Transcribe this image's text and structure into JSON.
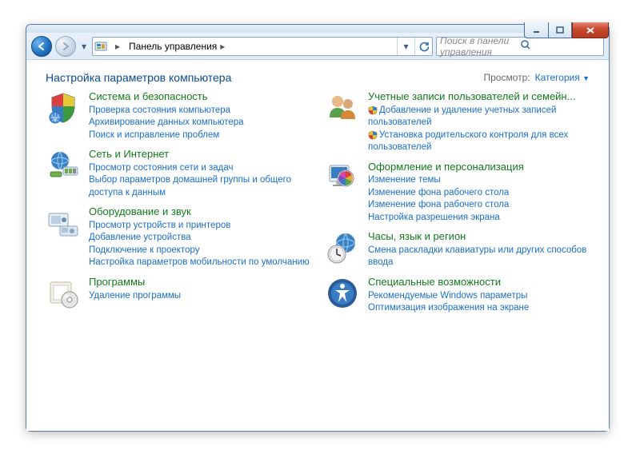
{
  "window": {
    "breadcrumb": "Панель управления",
    "search_placeholder": "Поиск в панели управления"
  },
  "header": {
    "title": "Настройка параметров компьютера",
    "view_label": "Просмотр:",
    "view_mode": "Категория"
  },
  "left": [
    {
      "icon": "system-security-icon",
      "title": "Система и безопасность",
      "links": [
        {
          "text": "Проверка состояния компьютера"
        },
        {
          "text": "Архивирование данных компьютера"
        },
        {
          "text": "Поиск и исправление проблем"
        }
      ]
    },
    {
      "icon": "network-icon",
      "title": "Сеть и Интернет",
      "links": [
        {
          "text": "Просмотр состояния сети и задач"
        },
        {
          "text": "Выбор параметров домашней группы и общего доступа к данным"
        }
      ]
    },
    {
      "icon": "hardware-sound-icon",
      "title": "Оборудование и звук",
      "links": [
        {
          "text": "Просмотр устройств и принтеров"
        },
        {
          "text": "Добавление устройства"
        },
        {
          "text": "Подключение к проектору"
        },
        {
          "text": "Настройка параметров мобильности по умолчанию"
        }
      ]
    },
    {
      "icon": "programs-icon",
      "title": "Программы",
      "links": [
        {
          "text": "Удаление программы"
        }
      ]
    }
  ],
  "right": [
    {
      "icon": "user-accounts-icon",
      "title": "Учетные записи пользователей и семейн...",
      "links": [
        {
          "text": "Добавление и удаление учетных записей пользователей",
          "shield": true
        },
        {
          "text": "Установка родительского контроля для всех пользователей",
          "shield": true
        }
      ]
    },
    {
      "icon": "appearance-icon",
      "title": "Оформление и персонализация",
      "links": [
        {
          "text": "Изменение темы"
        },
        {
          "text": "Изменение фона рабочего стола"
        },
        {
          "text": "Изменение фона рабочего стола"
        },
        {
          "text": "Настройка разрешения экрана"
        }
      ]
    },
    {
      "icon": "clock-lang-region-icon",
      "title": "Часы, язык и регион",
      "links": [
        {
          "text": "Смена раскладки клавиатуры или других способов ввода"
        }
      ]
    },
    {
      "icon": "ease-of-access-icon",
      "title": "Специальные возможности",
      "links": [
        {
          "text": "Рекомендуемые Windows параметры"
        },
        {
          "text": "Оптимизация изображения на экране"
        }
      ]
    }
  ]
}
